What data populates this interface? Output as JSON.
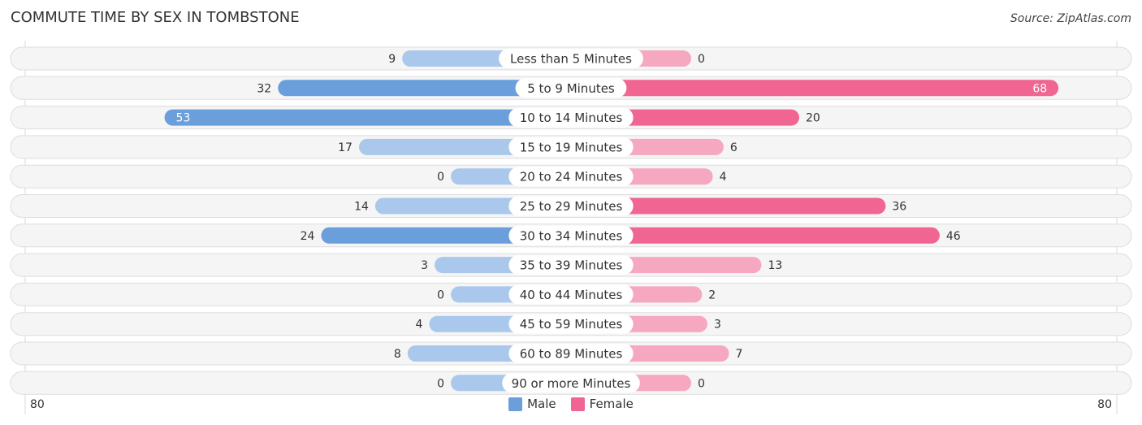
{
  "chart_data": {
    "type": "bar",
    "orientation": "horizontal-diverging",
    "title": "COMMUTE TIME BY SEX IN TOMBSTONE",
    "source": "Source: ZipAtlas.com",
    "categories": [
      "Less than 5 Minutes",
      "5 to 9 Minutes",
      "10 to 14 Minutes",
      "15 to 19 Minutes",
      "20 to 24 Minutes",
      "25 to 29 Minutes",
      "30 to 34 Minutes",
      "35 to 39 Minutes",
      "40 to 44 Minutes",
      "45 to 59 Minutes",
      "60 to 89 Minutes",
      "90 or more Minutes"
    ],
    "series": [
      {
        "name": "Male",
        "color": "#6a9fdb",
        "light_color": "#a9c8ec",
        "values": [
          9,
          32,
          53,
          17,
          0,
          14,
          24,
          3,
          0,
          4,
          8,
          0
        ]
      },
      {
        "name": "Female",
        "color": "#f06592",
        "light_color": "#f5a8c0",
        "values": [
          0,
          68,
          20,
          6,
          4,
          36,
          46,
          13,
          2,
          3,
          7,
          0
        ]
      }
    ],
    "axis": {
      "left_label": "80",
      "right_label": "80",
      "max": 80
    },
    "legend": {
      "position": "bottom-center",
      "items": [
        "Male",
        "Female"
      ]
    }
  }
}
